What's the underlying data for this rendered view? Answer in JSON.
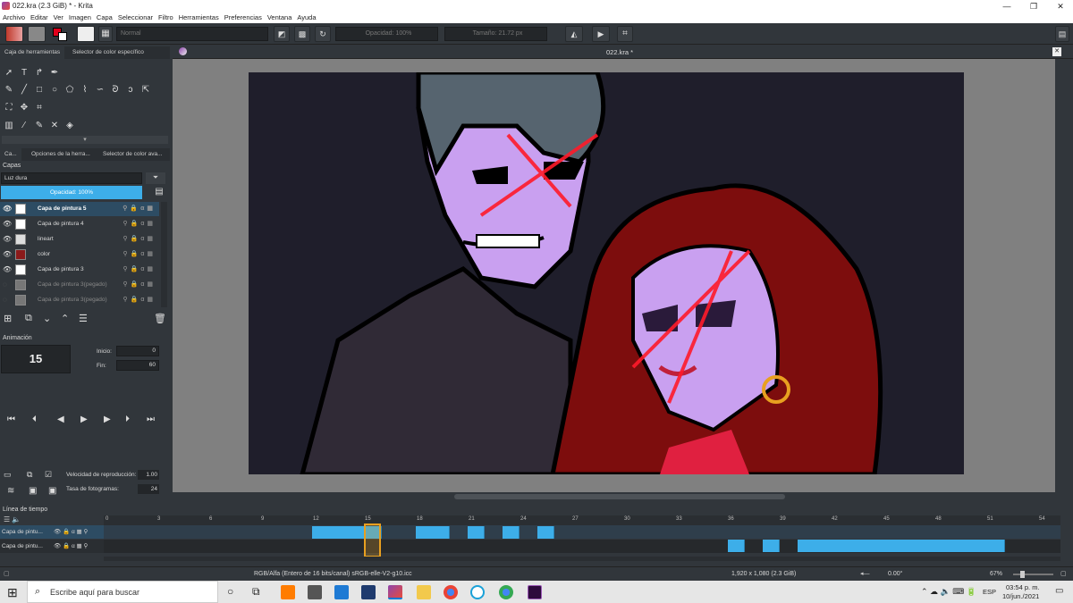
{
  "window": {
    "title": "022.kra (2.3 GiB)  * - Krita",
    "min": "—",
    "max": "❐",
    "close": "✕"
  },
  "menu": [
    "Archivo",
    "Editar",
    "Ver",
    "Imagen",
    "Capa",
    "Seleccionar",
    "Filtro",
    "Herramientas",
    "Preferencias",
    "Ventana",
    "Ayuda"
  ],
  "tool_options": {
    "blend_mode": "Normal",
    "opacity": "Opacidad: 100%",
    "size": "Tamaño: 21.72 px"
  },
  "left_tabs": {
    "toolbox": "Caja de herramientas",
    "color_selector": "Selector de color específico"
  },
  "dock_tabs": {
    "layers": "Ca...",
    "tool_options": "Opciones de la herra...",
    "advanced_color": "Selector de color ava..."
  },
  "layers": {
    "title": "Capas",
    "blend": "Luz dura",
    "opacity": "Opacidad:  100%",
    "items": [
      {
        "name": "Capa de pintura 5",
        "active": true
      },
      {
        "name": "Capa de pintura 4",
        "active": false
      },
      {
        "name": "lineart",
        "active": false
      },
      {
        "name": "color",
        "active": false
      },
      {
        "name": "Capa de pintura 3",
        "active": false
      },
      {
        "name": "Capa de pintura 3(pegado)",
        "active": false,
        "hidden": true
      },
      {
        "name": "Capa de pintura 3(pegado)",
        "active": false,
        "hidden": true
      }
    ]
  },
  "animation": {
    "title": "Animación",
    "frame": "15",
    "start_label": "Inicio:",
    "start": "0",
    "end_label": "Fin:",
    "end": "60",
    "speed_label": "Velocidad de reproducción:",
    "speed": "1.00",
    "fps_label": "Tasa de fotogramas:",
    "fps": "24"
  },
  "document": {
    "tab_title": "022.kra *"
  },
  "timeline": {
    "title": "Línea de tiempo",
    "ticks": [
      "0",
      "3",
      "6",
      "9",
      "12",
      "15",
      "18",
      "21",
      "24",
      "27",
      "30",
      "33",
      "36",
      "39",
      "42",
      "45",
      "48",
      "51",
      "54"
    ],
    "tracks": [
      "Capa de pintu...",
      "Capa de pintu..."
    ]
  },
  "status": {
    "color_space": "RGB/Alfa (Entero de 16 bits/canal)  sRGB-elle-V2-g10.icc",
    "dimensions": "1,920 x 1,080 (2.3 GiB)",
    "rotation": "0.00°",
    "zoom": "67%"
  },
  "taskbar": {
    "search_placeholder": "Escribe aquí para buscar",
    "lang": "ESP",
    "time": "03:54 p. m.",
    "date": "10/jun./2021"
  },
  "colors": {
    "accent": "#3daee9",
    "panel": "#31363b",
    "canvas_bg": "#1f1e2b"
  }
}
